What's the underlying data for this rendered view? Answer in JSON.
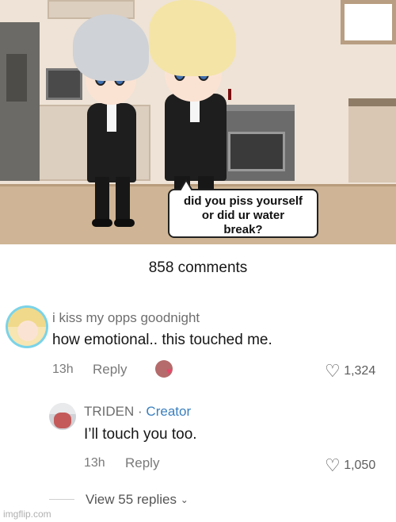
{
  "scene": {
    "speech_bubble": {
      "line1": "did you piss yourself",
      "line2": "or did ur water",
      "line3": "break?"
    }
  },
  "comments": {
    "count_label": "858 comments",
    "main": {
      "username": "i kiss my opps goodnight",
      "text": "how emotional.. this touched me.",
      "time": "13h",
      "reply_label": "Reply",
      "likes": "1,324"
    },
    "reply": {
      "username": "TRIDEN",
      "separator": "·",
      "creator_badge": "Creator",
      "text": "I’ll touch you too.",
      "time": "13h",
      "reply_label": "Reply",
      "likes": "1,050"
    },
    "view_replies_label": "View 55 replies",
    "view_replies_icon": "chevron-down-icon"
  },
  "watermark": "imgflip.com",
  "colors": {
    "creator": "#3a7fbf",
    "avatar_ring": "#7ad3e8",
    "heart_badge": "#e8456a"
  }
}
